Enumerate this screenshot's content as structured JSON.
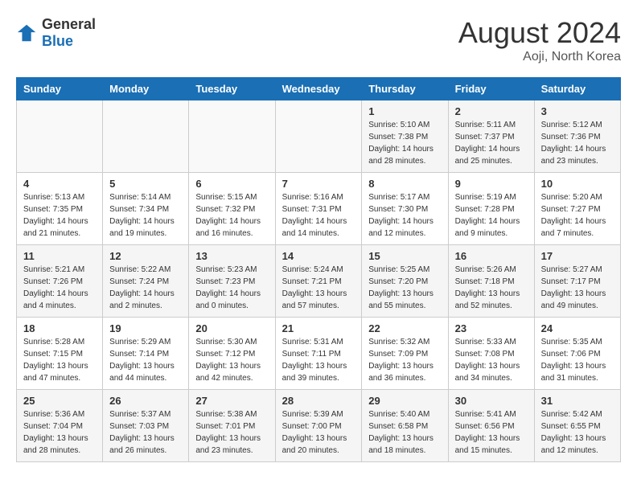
{
  "header": {
    "logo": {
      "general": "General",
      "blue": "Blue"
    },
    "title": "August 2024",
    "location": "Aoji, North Korea"
  },
  "weekdays": [
    "Sunday",
    "Monday",
    "Tuesday",
    "Wednesday",
    "Thursday",
    "Friday",
    "Saturday"
  ],
  "weeks": [
    [
      {
        "day": "",
        "info": ""
      },
      {
        "day": "",
        "info": ""
      },
      {
        "day": "",
        "info": ""
      },
      {
        "day": "",
        "info": ""
      },
      {
        "day": "1",
        "info": "Sunrise: 5:10 AM\nSunset: 7:38 PM\nDaylight: 14 hours\nand 28 minutes."
      },
      {
        "day": "2",
        "info": "Sunrise: 5:11 AM\nSunset: 7:37 PM\nDaylight: 14 hours\nand 25 minutes."
      },
      {
        "day": "3",
        "info": "Sunrise: 5:12 AM\nSunset: 7:36 PM\nDaylight: 14 hours\nand 23 minutes."
      }
    ],
    [
      {
        "day": "4",
        "info": "Sunrise: 5:13 AM\nSunset: 7:35 PM\nDaylight: 14 hours\nand 21 minutes."
      },
      {
        "day": "5",
        "info": "Sunrise: 5:14 AM\nSunset: 7:34 PM\nDaylight: 14 hours\nand 19 minutes."
      },
      {
        "day": "6",
        "info": "Sunrise: 5:15 AM\nSunset: 7:32 PM\nDaylight: 14 hours\nand 16 minutes."
      },
      {
        "day": "7",
        "info": "Sunrise: 5:16 AM\nSunset: 7:31 PM\nDaylight: 14 hours\nand 14 minutes."
      },
      {
        "day": "8",
        "info": "Sunrise: 5:17 AM\nSunset: 7:30 PM\nDaylight: 14 hours\nand 12 minutes."
      },
      {
        "day": "9",
        "info": "Sunrise: 5:19 AM\nSunset: 7:28 PM\nDaylight: 14 hours\nand 9 minutes."
      },
      {
        "day": "10",
        "info": "Sunrise: 5:20 AM\nSunset: 7:27 PM\nDaylight: 14 hours\nand 7 minutes."
      }
    ],
    [
      {
        "day": "11",
        "info": "Sunrise: 5:21 AM\nSunset: 7:26 PM\nDaylight: 14 hours\nand 4 minutes."
      },
      {
        "day": "12",
        "info": "Sunrise: 5:22 AM\nSunset: 7:24 PM\nDaylight: 14 hours\nand 2 minutes."
      },
      {
        "day": "13",
        "info": "Sunrise: 5:23 AM\nSunset: 7:23 PM\nDaylight: 14 hours\nand 0 minutes."
      },
      {
        "day": "14",
        "info": "Sunrise: 5:24 AM\nSunset: 7:21 PM\nDaylight: 13 hours\nand 57 minutes."
      },
      {
        "day": "15",
        "info": "Sunrise: 5:25 AM\nSunset: 7:20 PM\nDaylight: 13 hours\nand 55 minutes."
      },
      {
        "day": "16",
        "info": "Sunrise: 5:26 AM\nSunset: 7:18 PM\nDaylight: 13 hours\nand 52 minutes."
      },
      {
        "day": "17",
        "info": "Sunrise: 5:27 AM\nSunset: 7:17 PM\nDaylight: 13 hours\nand 49 minutes."
      }
    ],
    [
      {
        "day": "18",
        "info": "Sunrise: 5:28 AM\nSunset: 7:15 PM\nDaylight: 13 hours\nand 47 minutes."
      },
      {
        "day": "19",
        "info": "Sunrise: 5:29 AM\nSunset: 7:14 PM\nDaylight: 13 hours\nand 44 minutes."
      },
      {
        "day": "20",
        "info": "Sunrise: 5:30 AM\nSunset: 7:12 PM\nDaylight: 13 hours\nand 42 minutes."
      },
      {
        "day": "21",
        "info": "Sunrise: 5:31 AM\nSunset: 7:11 PM\nDaylight: 13 hours\nand 39 minutes."
      },
      {
        "day": "22",
        "info": "Sunrise: 5:32 AM\nSunset: 7:09 PM\nDaylight: 13 hours\nand 36 minutes."
      },
      {
        "day": "23",
        "info": "Sunrise: 5:33 AM\nSunset: 7:08 PM\nDaylight: 13 hours\nand 34 minutes."
      },
      {
        "day": "24",
        "info": "Sunrise: 5:35 AM\nSunset: 7:06 PM\nDaylight: 13 hours\nand 31 minutes."
      }
    ],
    [
      {
        "day": "25",
        "info": "Sunrise: 5:36 AM\nSunset: 7:04 PM\nDaylight: 13 hours\nand 28 minutes."
      },
      {
        "day": "26",
        "info": "Sunrise: 5:37 AM\nSunset: 7:03 PM\nDaylight: 13 hours\nand 26 minutes."
      },
      {
        "day": "27",
        "info": "Sunrise: 5:38 AM\nSunset: 7:01 PM\nDaylight: 13 hours\nand 23 minutes."
      },
      {
        "day": "28",
        "info": "Sunrise: 5:39 AM\nSunset: 7:00 PM\nDaylight: 13 hours\nand 20 minutes."
      },
      {
        "day": "29",
        "info": "Sunrise: 5:40 AM\nSunset: 6:58 PM\nDaylight: 13 hours\nand 18 minutes."
      },
      {
        "day": "30",
        "info": "Sunrise: 5:41 AM\nSunset: 6:56 PM\nDaylight: 13 hours\nand 15 minutes."
      },
      {
        "day": "31",
        "info": "Sunrise: 5:42 AM\nSunset: 6:55 PM\nDaylight: 13 hours\nand 12 minutes."
      }
    ]
  ]
}
